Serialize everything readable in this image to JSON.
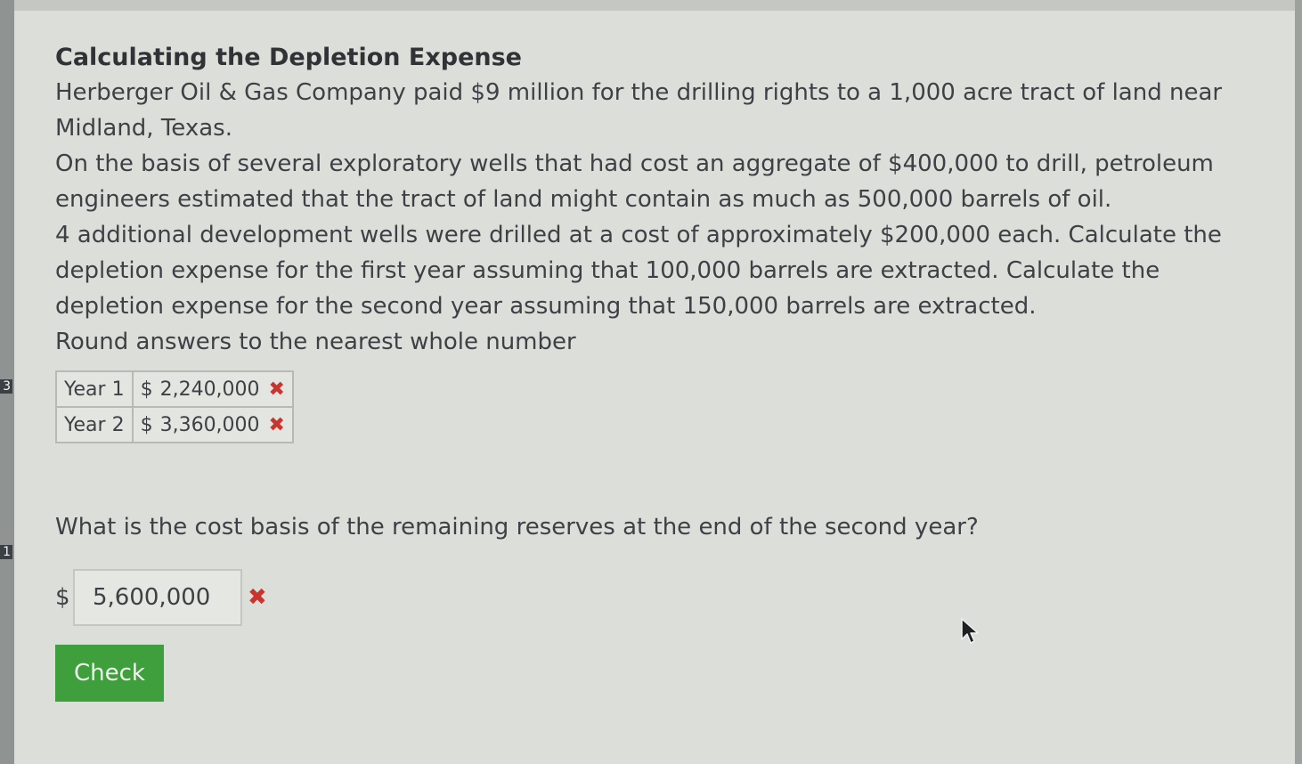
{
  "left_strip": {
    "marks": [
      "3",
      "1"
    ]
  },
  "problem": {
    "title": "Calculating the Depletion Expense",
    "paragraph_1": "Herberger Oil & Gas Company paid $9 million for the drilling rights to a 1,000 acre tract of land near Midland, Texas.",
    "paragraph_2": "On the basis of several exploratory wells that had cost an aggregate of $400,000 to drill, petroleum engineers estimated that the tract of land might contain as much as 500,000 barrels of oil.",
    "paragraph_3": "4 additional development wells were drilled at a cost of approximately $200,000 each. Calculate the depletion expense for the first year assuming that 100,000 barrels are extracted. Calculate the depletion expense for the second year assuming that 150,000 barrels are extracted.",
    "instruction": "Round answers to the nearest whole number"
  },
  "answers_table": {
    "rows": [
      {
        "label": "Year 1",
        "currency": "$",
        "value": "2,240,000",
        "status": "incorrect"
      },
      {
        "label": "Year 2",
        "currency": "$",
        "value": "3,360,000",
        "status": "incorrect"
      }
    ],
    "incorrect_symbol": "✖",
    "incorrect_color": "#c9352e"
  },
  "question_2": {
    "text": "What is the cost basis of the remaining reserves at the end of the second year?",
    "currency": "$",
    "answer_value": "5,600,000",
    "status": "incorrect",
    "incorrect_symbol": "✖"
  },
  "check_button": {
    "label": "Check",
    "color": "#3f9f3c"
  }
}
